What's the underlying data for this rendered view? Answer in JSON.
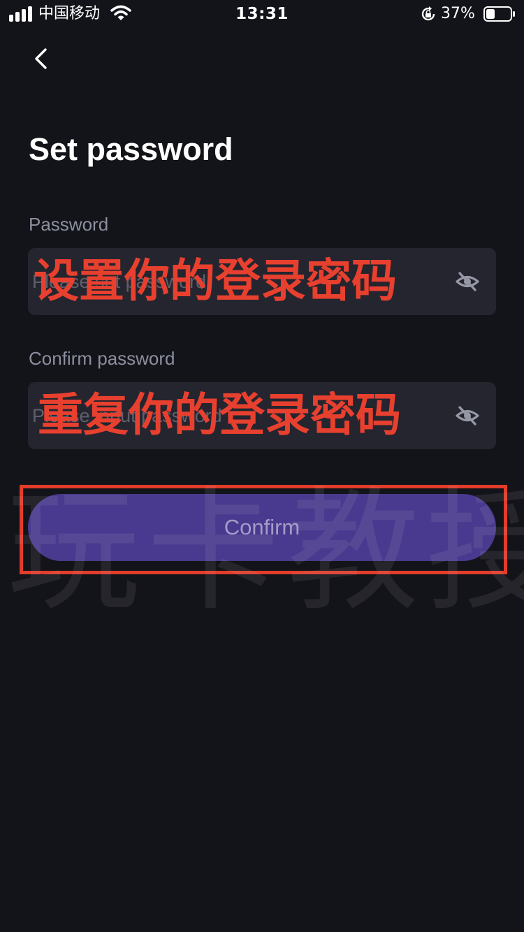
{
  "status_bar": {
    "carrier": "中国移动",
    "time": "13:31",
    "battery_percent": "37%",
    "icons": [
      "signal-icon",
      "wifi-icon",
      "rotation-lock-icon",
      "battery-icon"
    ]
  },
  "header": {
    "back_icon": "chevron-left-icon"
  },
  "page": {
    "title": "Set password"
  },
  "form": {
    "password": {
      "label": "Password",
      "placeholder": "Please set password",
      "annotation": "设置你的登录密码",
      "toggle_icon": "eye-off-icon"
    },
    "confirm_password": {
      "label": "Confirm password",
      "placeholder": "Please input password",
      "annotation": "重复你的登录密码",
      "toggle_icon": "eye-off-icon"
    },
    "confirm_button": {
      "label": "Confirm"
    }
  },
  "overlay": {
    "watermark": "玩卡教授"
  },
  "colors": {
    "background": "#131419",
    "field_background": "#24252f",
    "button_background": "#4a3a8f",
    "button_text": "#a49bc7",
    "annotation_red": "#e8402f"
  }
}
